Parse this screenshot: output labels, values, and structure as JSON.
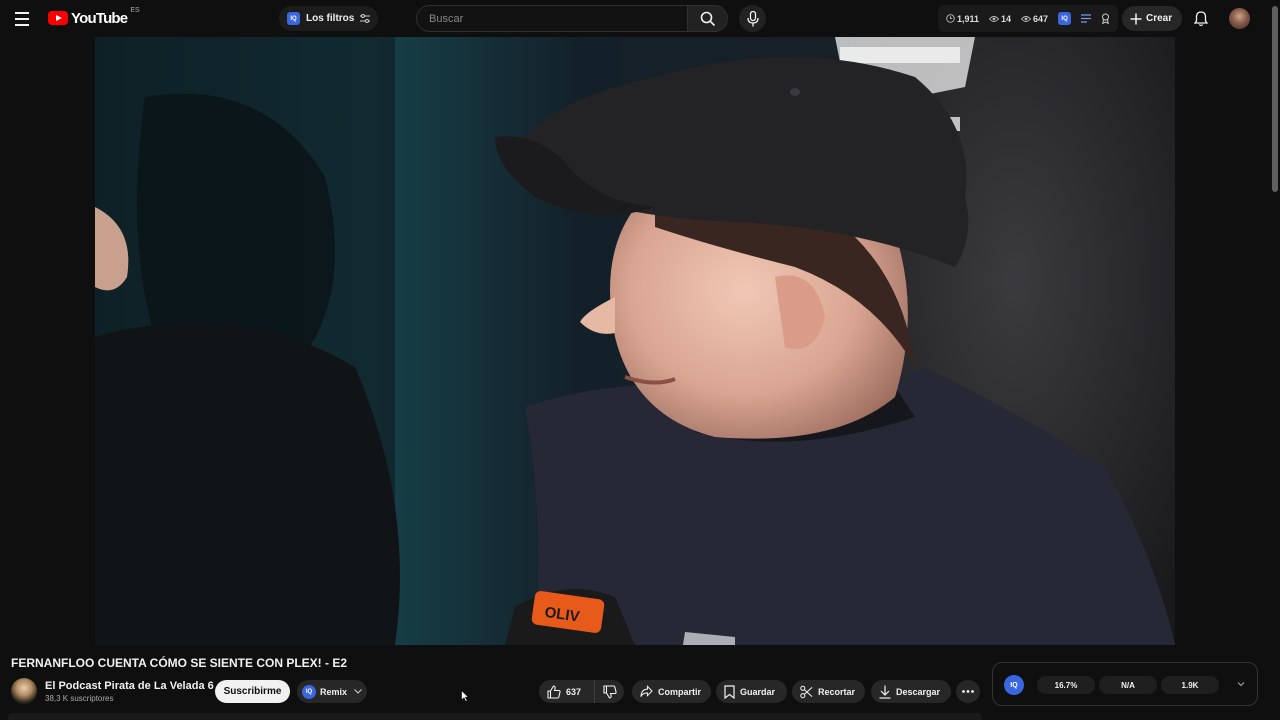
{
  "app": {
    "logo_text": "YouTube",
    "country_code": "ES"
  },
  "filters": {
    "label": "Los filtros"
  },
  "search": {
    "placeholder": "Buscar"
  },
  "stats": {
    "views": "1,911",
    "comments": "14",
    "watching": "647"
  },
  "create": {
    "label": "Crear"
  },
  "video": {
    "title": "FERNANFLOO CUENTA CÓMO SE SIENTE CON PLEX! - E2",
    "mic_text": "OLIV"
  },
  "channel": {
    "name": "El Podcast Pirata de La Velada 6",
    "subscribers": "38,3 K suscriptores",
    "subscribe_label": "Suscribirme"
  },
  "remix": {
    "label": "Remix",
    "badge": "IQ"
  },
  "actions": {
    "likes": "637",
    "share": "Compartir",
    "save": "Guardar",
    "clip": "Recortar",
    "download": "Descargar"
  },
  "iq_panel": {
    "badge": "IQ",
    "metric_1": "16.7%",
    "metric_2": "N/A",
    "metric_3": "1.9K"
  },
  "colors": {
    "accent": "#3a66e0",
    "brand": "#ff0000",
    "background": "#0f0f0f"
  }
}
